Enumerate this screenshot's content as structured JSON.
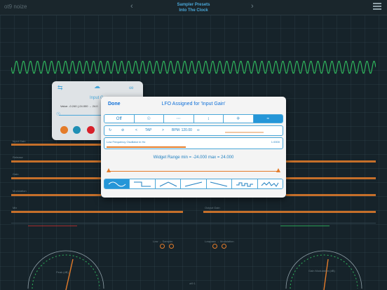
{
  "topbar": {
    "brand": "ot9 noize",
    "preset_line1": "Sampler Presets",
    "preset_line2": "Into The Clock",
    "prev_icon": "chevron-left-icon",
    "next_icon": "chevron-right-icon",
    "menu_icon": "hamburger-menu-icon"
  },
  "background_params": {
    "left_labels": [
      "Input Gain",
      "Release",
      "Gain",
      "Modulation",
      "Mix"
    ],
    "right_labels": [
      "",
      "",
      "",
      "",
      "Output Gain"
    ],
    "bottom_left": "Low → Sampler",
    "bottom_right": "Lowpass → Modulation",
    "gauge_left_label": "Peak (dB)",
    "gauge_right_label": "Gain Modulation (dB)",
    "bottom_center": "ot9 1"
  },
  "input_panel": {
    "title": "Input G",
    "value": "Value: -0.240 (-24.000 → 24.0",
    "icons": [
      "shuffle-icon",
      "cloud-upload-icon",
      "link-icon",
      "walk-icon"
    ],
    "slider_fraction": 0.75,
    "dot_colors": [
      "#e47c2a",
      "#1f8fb5",
      "#d8202a"
    ]
  },
  "dialog": {
    "done": "Done",
    "title": "LFO Assigned for 'Input Gain'",
    "modes": [
      "Off"
    ],
    "mode_icons": [
      "knob-icon",
      "dots-icon",
      "updown-arrow-icon",
      "crosshair-icon",
      "waves-icon"
    ],
    "controls": {
      "tap": "TAP",
      "bpm": "BPM: 120.00",
      "lt": "<",
      "gt": ">"
    },
    "freq_label": "Low Frequency Oscillator in Hz",
    "freq_value": "1.0000",
    "freq_fraction": 0.45,
    "range_text": "Widget Range min = -24.000 max = 24.000",
    "waveforms": [
      "sine-wave-icon",
      "square-wave-icon",
      "triangle-wave-icon",
      "ramp-up-icon",
      "ramp-down-icon",
      "stepped-random-icon",
      "smooth-random-icon"
    ]
  },
  "colors": {
    "accent": "#2596d8",
    "orange": "#e47c2a",
    "wave": "#2fb55d"
  }
}
